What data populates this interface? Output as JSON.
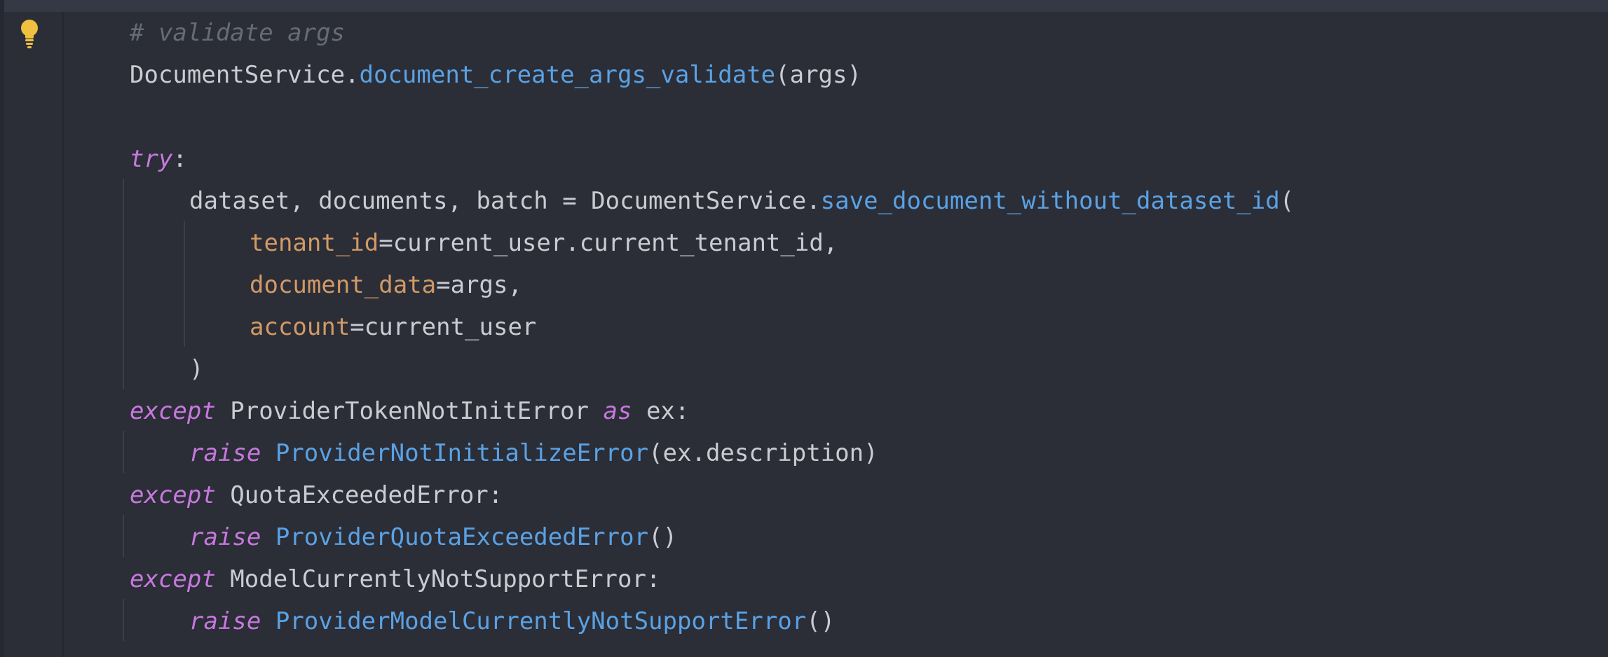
{
  "theme": {
    "background": "#2b2d37",
    "gutter_edge": "#262831",
    "top_bar": "#353845",
    "indent_guide": "#3b3f4c",
    "comment": "#666b78",
    "plain": "#c9ccd3",
    "function": "#5aa2e4",
    "keyword": "#c679dd",
    "parameter": "#d19a66",
    "bulb": "#f0c040"
  },
  "gutter": {
    "icon": "lightbulb-icon"
  },
  "lines": [
    {
      "tokens": [
        {
          "t": "# validate args",
          "k": "comment"
        }
      ]
    },
    {
      "tokens": [
        {
          "t": "DocumentService.",
          "k": "plain"
        },
        {
          "t": "document_create_args_validate",
          "k": "func"
        },
        {
          "t": "(args)",
          "k": "plain"
        }
      ]
    },
    {
      "tokens": []
    },
    {
      "tokens": [
        {
          "t": "try",
          "k": "kw"
        },
        {
          "t": ":",
          "k": "plain"
        }
      ]
    },
    {
      "tokens": [
        {
          "t": "dataset, documents, batch = DocumentService.",
          "k": "plain"
        },
        {
          "t": "save_document_without_dataset_id",
          "k": "func"
        },
        {
          "t": "(",
          "k": "plain"
        }
      ]
    },
    {
      "tokens": [
        {
          "t": "tenant_id",
          "k": "param"
        },
        {
          "t": "=current_user.current_tenant_id,",
          "k": "plain"
        }
      ]
    },
    {
      "tokens": [
        {
          "t": "document_data",
          "k": "param"
        },
        {
          "t": "=args,",
          "k": "plain"
        }
      ]
    },
    {
      "tokens": [
        {
          "t": "account",
          "k": "param"
        },
        {
          "t": "=current_user",
          "k": "plain"
        }
      ]
    },
    {
      "tokens": [
        {
          "t": ")",
          "k": "plain"
        }
      ]
    },
    {
      "tokens": [
        {
          "t": "except",
          "k": "kw"
        },
        {
          "t": " ProviderTokenNotInitError ",
          "k": "plain"
        },
        {
          "t": "as",
          "k": "kw"
        },
        {
          "t": " ex:",
          "k": "plain"
        }
      ]
    },
    {
      "tokens": [
        {
          "t": "raise",
          "k": "kw"
        },
        {
          "t": " ",
          "k": "plain"
        },
        {
          "t": "ProviderNotInitializeError",
          "k": "func"
        },
        {
          "t": "(ex.description)",
          "k": "plain"
        }
      ]
    },
    {
      "tokens": [
        {
          "t": "except",
          "k": "kw"
        },
        {
          "t": " QuotaExceededError:",
          "k": "plain"
        }
      ]
    },
    {
      "tokens": [
        {
          "t": "raise",
          "k": "kw"
        },
        {
          "t": " ",
          "k": "plain"
        },
        {
          "t": "ProviderQuotaExceededError",
          "k": "func"
        },
        {
          "t": "()",
          "k": "plain"
        }
      ]
    },
    {
      "tokens": [
        {
          "t": "except",
          "k": "kw"
        },
        {
          "t": " ModelCurrentlyNotSupportError:",
          "k": "plain"
        }
      ]
    },
    {
      "tokens": [
        {
          "t": "raise",
          "k": "kw"
        },
        {
          "t": " ",
          "k": "plain"
        },
        {
          "t": "ProviderModelCurrentlyNotSupportError",
          "k": "func"
        },
        {
          "t": "()",
          "k": "plain"
        }
      ]
    }
  ]
}
